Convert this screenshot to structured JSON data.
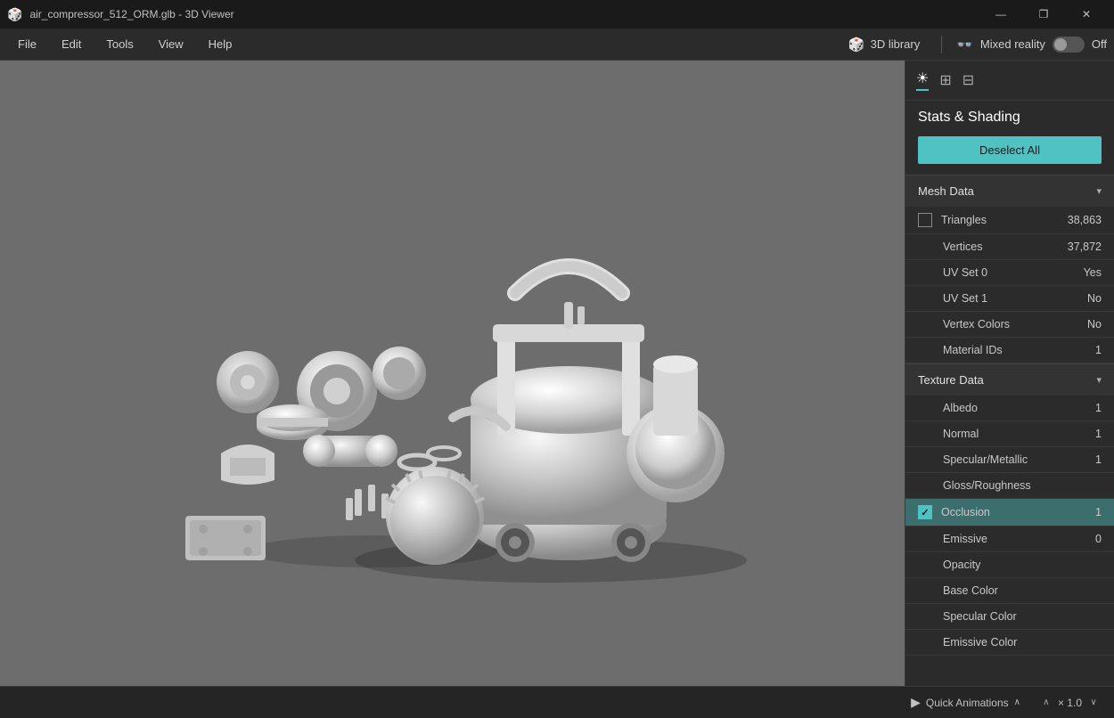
{
  "titlebar": {
    "title": "air_compressor_512_ORM.glb - 3D Viewer",
    "controls": {
      "minimize": "—",
      "restore": "❐",
      "close": "✕"
    }
  },
  "menubar": {
    "items": [
      "File",
      "Edit",
      "Tools",
      "View",
      "Help"
    ],
    "library_btn": "3D library",
    "mixed_reality_label": "Mixed reality",
    "mixed_reality_toggle": "Off"
  },
  "panel": {
    "toolbar_icons": [
      "☀",
      "⊞",
      "⊟"
    ],
    "title": "Stats & Shading",
    "deselect_all": "Deselect All",
    "mesh_data": {
      "label": "Mesh Data",
      "rows": [
        {
          "label": "Triangles",
          "value": "38,863",
          "has_checkbox": true,
          "checked": false
        },
        {
          "label": "Vertices",
          "value": "37,872",
          "has_checkbox": false
        },
        {
          "label": "UV Set 0",
          "value": "Yes",
          "has_checkbox": false
        },
        {
          "label": "UV Set 1",
          "value": "No",
          "has_checkbox": false
        },
        {
          "label": "Vertex Colors",
          "value": "No",
          "has_checkbox": false
        },
        {
          "label": "Material IDs",
          "value": "1",
          "has_checkbox": false
        }
      ]
    },
    "texture_data": {
      "label": "Texture Data",
      "rows": [
        {
          "label": "Albedo",
          "value": "1",
          "has_checkbox": false,
          "highlighted": false
        },
        {
          "label": "Normal",
          "value": "1",
          "has_checkbox": false,
          "highlighted": false
        },
        {
          "label": "Specular/Metallic",
          "value": "1",
          "has_checkbox": false,
          "highlighted": false
        },
        {
          "label": "Gloss/Roughness",
          "value": "",
          "has_checkbox": false,
          "highlighted": false
        },
        {
          "label": "Occlusion",
          "value": "1",
          "has_checkbox": true,
          "checked": true,
          "highlighted": true
        },
        {
          "label": "Emissive",
          "value": "0",
          "has_checkbox": false,
          "highlighted": false
        },
        {
          "label": "Opacity",
          "value": "",
          "has_checkbox": false,
          "highlighted": false
        },
        {
          "label": "Base Color",
          "value": "",
          "has_checkbox": false,
          "highlighted": false
        },
        {
          "label": "Specular Color",
          "value": "",
          "has_checkbox": false,
          "highlighted": false
        },
        {
          "label": "Emissive Color",
          "value": "",
          "has_checkbox": false,
          "highlighted": false
        }
      ]
    }
  },
  "bottombar": {
    "quick_animations": "Quick Animations",
    "zoom_up": "∧",
    "zoom_value": "× 1.0",
    "zoom_down": "∨"
  },
  "colors": {
    "accent": "#4fc3c3",
    "panel_bg": "#2b2b2b",
    "viewport_bg": "#6d6d6d",
    "highlight_row": "#3d6e6e"
  }
}
